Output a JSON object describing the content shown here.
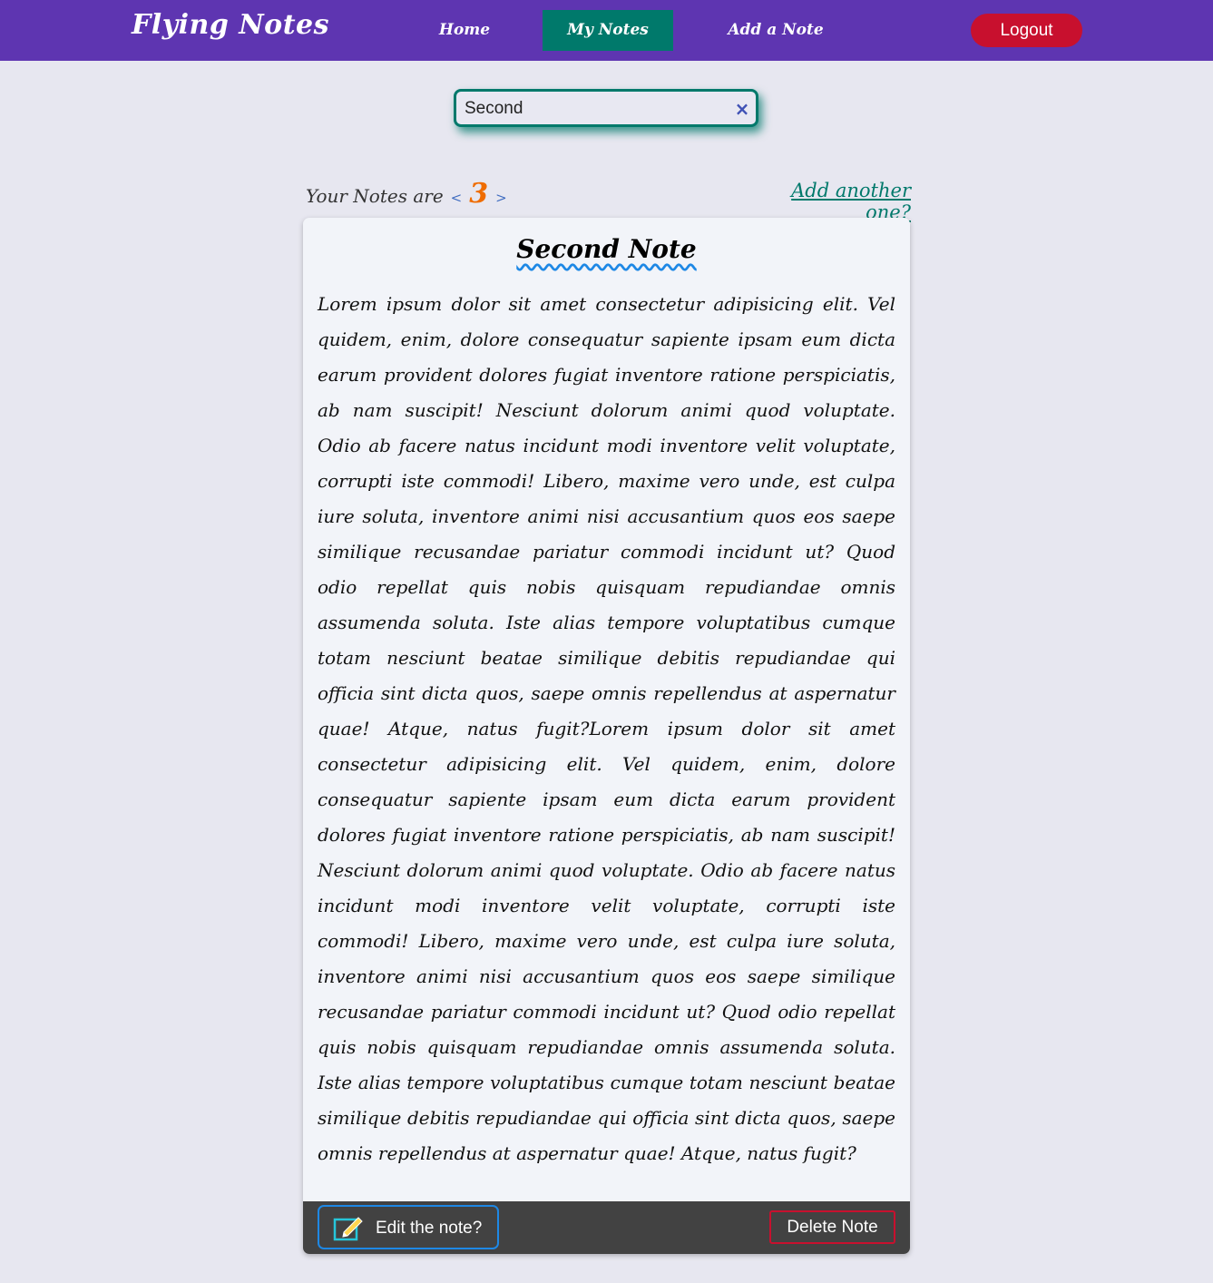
{
  "navbar": {
    "brand": "Flying Notes",
    "links": [
      "Home",
      "My Notes",
      "Add a Note"
    ],
    "logout_label": "Logout",
    "colors": {
      "background": "#5e35b1",
      "active_link": "#00796b",
      "logout": "#c8102e"
    }
  },
  "search": {
    "value": "Second",
    "clear_icon": "×"
  },
  "notes_summary": {
    "prefix": "Your Notes are",
    "prev_arrow": "<",
    "count": "3",
    "next_arrow": ">",
    "add_another": "Add another one?"
  },
  "note": {
    "title": "Second Note",
    "body": "Lorem ipsum dolor sit amet consectetur adipisicing elit. Vel quidem, enim, dolore consequatur sapiente ipsam eum dicta earum provident dolores fugiat inventore ratione perspiciatis, ab nam suscipit! Nesciunt dolorum animi quod voluptate. Odio ab facere natus incidunt modi inventore velit voluptate, corrupti iste commodi! Libero, maxime vero unde, est culpa iure soluta, inventore animi nisi accusantium quos eos saepe similique recusandae pariatur commodi incidunt ut? Quod odio repellat quis nobis quisquam repudiandae omnis assumenda soluta. Iste alias tempore voluptatibus cumque totam nesciunt beatae similique debitis repudiandae qui officia sint dicta quos, saepe omnis repellendus at aspernatur quae! Atque, natus fugit?Lorem ipsum dolor sit amet consectetur adipisicing elit. Vel quidem, enim, dolore consequatur sapiente ipsam eum dicta earum provident dolores fugiat inventore ratione perspiciatis, ab nam suscipit! Nesciunt dolorum animi quod voluptate. Odio ab facere natus incidunt modi inventore velit voluptate, corrupti iste commodi! Libero, maxime vero unde, est culpa iure soluta, inventore animi nisi accusantium quos eos saepe similique recusandae pariatur commodi incidunt ut? Quod odio repellat quis nobis quisquam repudiandae omnis assumenda soluta. Iste alias tempore voluptatibus cumque totam nesciunt beatae similique debitis repudiandae qui officia sint dicta quos, saepe omnis repellendus at aspernatur quae! Atque, natus fugit?",
    "edit_label": "Edit the note?",
    "delete_label": "Delete Note",
    "edit_icon": "edit-pencil-icon"
  }
}
